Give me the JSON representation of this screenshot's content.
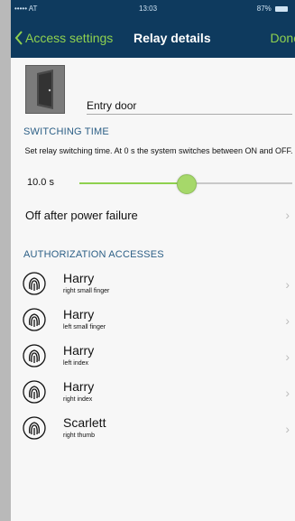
{
  "status_bar": {
    "carrier": "••••• AT",
    "time": "13:03",
    "battery": "87%"
  },
  "nav": {
    "back_label": "Access settings",
    "title": "Relay details",
    "done_label": "Done"
  },
  "door": {
    "icon": "door-icon",
    "name": "Entry door"
  },
  "switching_time": {
    "header": "SWITCHING TIME",
    "hint": "Set relay switching time. At 0 s the system switches between ON and OFF.",
    "value": "10.0 s",
    "slider_fraction": 0.5
  },
  "power_failure": {
    "label": "Off after power failure"
  },
  "accesses": {
    "header": "AUTHORIZATION ACCESSES",
    "items": [
      {
        "name": "Harry",
        "detail": "right small finger"
      },
      {
        "name": "Harry",
        "detail": "left small finger"
      },
      {
        "name": "Harry",
        "detail": "left index"
      },
      {
        "name": "Harry",
        "detail": "right index"
      },
      {
        "name": "Scarlett",
        "detail": "right thumb"
      }
    ]
  },
  "colors": {
    "nav_bg": "#0e3a5e",
    "accent_green": "#8fd14f",
    "section_blue": "#2c5f86"
  }
}
